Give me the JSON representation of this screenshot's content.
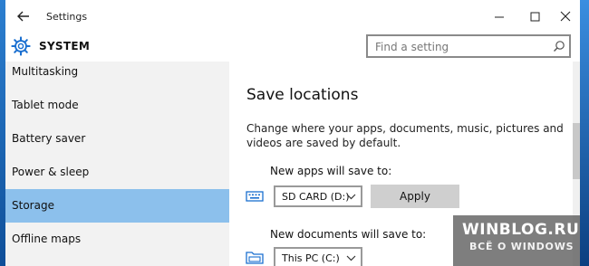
{
  "window": {
    "title": "Settings"
  },
  "header": {
    "section_title": "SYSTEM",
    "search_placeholder": "Find a setting"
  },
  "sidebar": {
    "items": [
      {
        "label": "Multitasking"
      },
      {
        "label": "Tablet mode"
      },
      {
        "label": "Battery saver"
      },
      {
        "label": "Power & sleep"
      },
      {
        "label": "Storage",
        "selected": true
      },
      {
        "label": "Offline maps"
      }
    ]
  },
  "content": {
    "heading": "Save locations",
    "description": "Change where your apps, documents, music, pictures and videos are saved by default.",
    "apps": {
      "label": "New apps will save to:",
      "value": "SD CARD (D:)",
      "apply_label": "Apply"
    },
    "documents": {
      "label": "New documents will save to:",
      "value": "This PC (C:)"
    }
  },
  "watermark": {
    "title": "WINBLOG.RU",
    "subtitle": "ВСЁ О WINDOWS"
  },
  "colors": {
    "selected_nav": "#8cc0ec",
    "sidebar_bg": "#f2f2f2",
    "accent": "#1a6fd0"
  },
  "icons": [
    "back-arrow-icon",
    "minimize-icon",
    "maximize-icon",
    "close-icon",
    "gear-icon",
    "search-icon",
    "keyboard-icon",
    "folder-icon",
    "chevron-down-icon"
  ]
}
